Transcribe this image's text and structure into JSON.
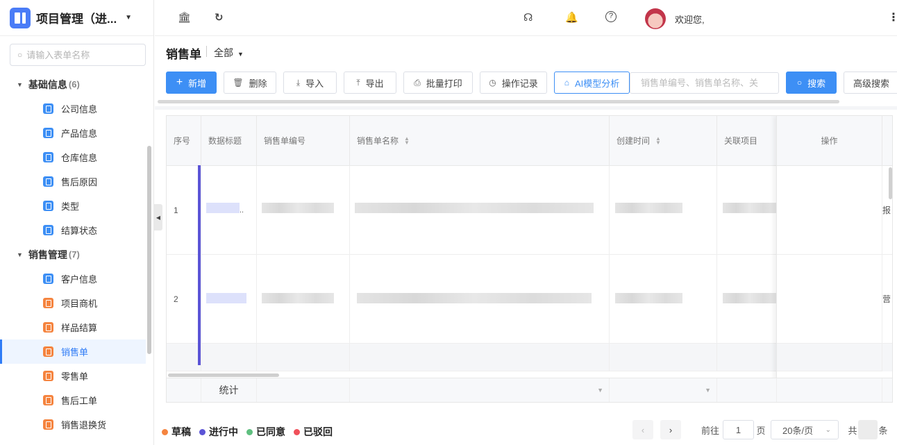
{
  "app": {
    "title": "项目管理（进..."
  },
  "sidebar": {
    "search_placeholder": "请输入表单名称",
    "groups": [
      {
        "label": "基础信息",
        "count": "(6)",
        "items": [
          "公司信息",
          "产品信息",
          "仓库信息",
          "售后原因",
          "类型",
          "结算状态"
        ]
      },
      {
        "label": "销售管理",
        "count": "(7)",
        "items": [
          "客户信息",
          "项目商机",
          "样品结算",
          "销售单",
          "零售单",
          "售后工单",
          "销售退换货"
        ]
      }
    ],
    "active_item": "销售单"
  },
  "header": {
    "welcome": "欢迎您,"
  },
  "page": {
    "title": "销售单",
    "filter": "全部"
  },
  "toolbar": {
    "add": "新增",
    "delete": "删除",
    "import": "导入",
    "export": "导出",
    "batch_print": "批量打印",
    "op_log": "操作记录",
    "ai": "AI模型分析",
    "search_placeholder": "销售单编号、销售单名称、关",
    "search": "搜索",
    "advanced": "高级搜索"
  },
  "table": {
    "columns": [
      "序号",
      "数据标题",
      "销售单编号",
      "销售单名称",
      "创建时间",
      "关联项目",
      "操作"
    ],
    "rows": [
      {
        "index": "1",
        "title_suffix": "..",
        "op_partial": "报"
      },
      {
        "index": "2",
        "title_suffix": "",
        "op_partial": "营"
      }
    ],
    "summary_label": "统计"
  },
  "legend": [
    {
      "label": "草稿",
      "color": "#f5843f"
    },
    {
      "label": "进行中",
      "color": "#5b54d6"
    },
    {
      "label": "已同意",
      "color": "#5fbf7f"
    },
    {
      "label": "已驳回",
      "color": "#f0505a"
    }
  ],
  "pagination": {
    "goto": "前往",
    "page": "1",
    "page_unit": "页",
    "size": "20条/页",
    "total_prefix": "共",
    "total_suffix": "条"
  }
}
